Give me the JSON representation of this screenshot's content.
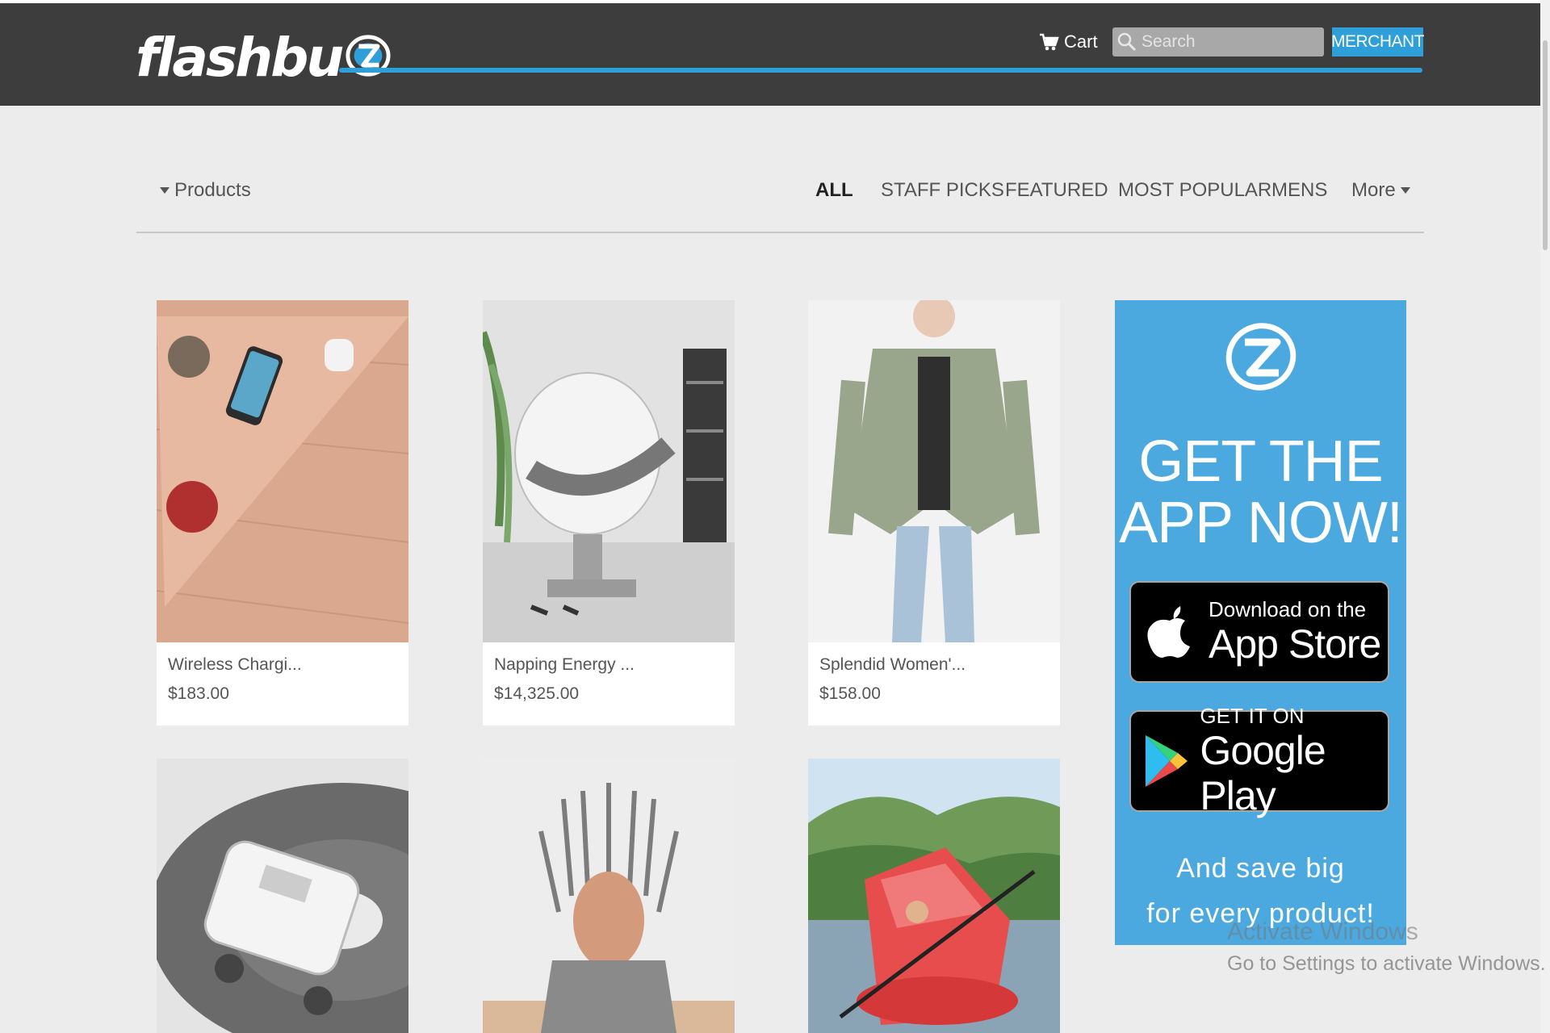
{
  "header": {
    "logo_text": "flashbu",
    "cart_label": "Cart",
    "search_placeholder": "Search",
    "merchant_label": "MERCHANT"
  },
  "filter": {
    "products_label": "Products",
    "tabs": [
      {
        "label": "ALL",
        "active": true
      },
      {
        "label": "STAFF PICKS",
        "active": false
      },
      {
        "label": "FEATURED",
        "active": false
      },
      {
        "label": "MOST POPULAR",
        "active": false
      },
      {
        "label": "MENS",
        "active": false
      },
      {
        "label": "More",
        "active": false
      }
    ]
  },
  "products": [
    {
      "name": "Wireless Chargi...",
      "price": "$183.00",
      "image": "wireless-charging-table"
    },
    {
      "name": "Napping Energy ...",
      "price": "$14,325.00",
      "image": "energy-pod-chair"
    },
    {
      "name": "Splendid Women'...",
      "price": "$158.00",
      "image": "utility-jacket"
    },
    {
      "name": "",
      "price": "",
      "image": "camper-van-speaker"
    },
    {
      "name": "",
      "price": "",
      "image": "iron-throne-egg-cup"
    },
    {
      "name": "",
      "price": "",
      "image": "kayak-tent"
    }
  ],
  "promo": {
    "headline_line1": "GET THE",
    "headline_line2": "APP NOW!",
    "appstore_small": "Download on the",
    "appstore_big": "App Store",
    "googleplay_small": "GET IT ON",
    "googleplay_big": "Google Play",
    "tagline_line1": "And save big",
    "tagline_line2": "for every product!"
  },
  "watermark": {
    "title": "Activate Windows",
    "subtitle": "Go to Settings to activate Windows."
  },
  "colors": {
    "header_bg": "#3d3d3d",
    "accent": "#2e9fd9",
    "promo_bg": "#4ba9e0",
    "page_bg": "#ececec"
  }
}
